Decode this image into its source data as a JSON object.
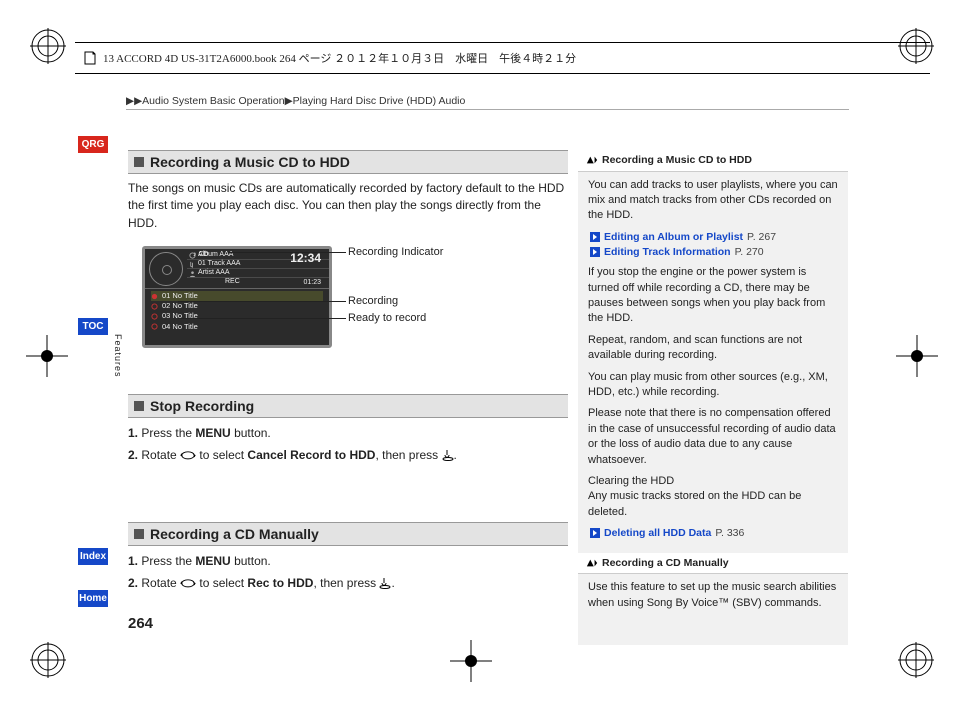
{
  "header_text": "13 ACCORD 4D US-31T2A6000.book  264 ページ  ２０１２年１０月３日　水曜日　午後４時２１分",
  "breadcrumb_prefix": "▶▶",
  "breadcrumb_a": "Audio System Basic Operation",
  "breadcrumb_sep": "▶",
  "breadcrumb_b": "Playing Hard Disc Drive (HDD) Audio",
  "tabs": {
    "qrg": "QRG",
    "toc": "TOC",
    "index": "Index",
    "home": "Home",
    "features": "Features"
  },
  "page_number": "264",
  "section1": {
    "title": "Recording a Music CD to HDD",
    "body": "The songs on music CDs are automatically recorded by factory default to the HDD the first time you play each disc. You can then play the songs directly from the HDD.",
    "callouts": {
      "indicator": "Recording Indicator",
      "recording": "Recording",
      "ready": "Ready to record"
    },
    "screen": {
      "cd": "CD",
      "time": "12:34",
      "elapsed": "01:23",
      "album": "Album AAA",
      "track": "01 Track AAA",
      "artist": "Artist AAA",
      "rec_btn": "REC",
      "tracks": [
        "01 No Title",
        "02 No Title",
        "03 No Title",
        "04 No Title"
      ]
    }
  },
  "section2": {
    "title": "Stop Recording",
    "step1_a": "1.",
    "step1_b": "Press the ",
    "step1_menu": "MENU",
    "step1_c": " button.",
    "step2_a": "2.",
    "step2_b": "Rotate ",
    "step2_c": " to select ",
    "step2_bold": "Cancel Record to HDD",
    "step2_d": ", then press "
  },
  "section3": {
    "title": "Recording a CD Manually",
    "step1_a": "1.",
    "step1_b": "Press the ",
    "step1_menu": "MENU",
    "step1_c": " button.",
    "step2_a": "2.",
    "step2_b": "Rotate ",
    "step2_c": " to select ",
    "step2_bold": "Rec to HDD",
    "step2_d": ", then press "
  },
  "sidebar": {
    "heading1": "Recording a Music CD to HDD",
    "p1": "You can add tracks to user playlists, where you can mix and match tracks from other CDs recorded on the HDD.",
    "xref1": "Editing an Album or Playlist",
    "xref1_pg": "P. 267",
    "xref2": "Editing Track Information",
    "xref2_pg": "P. 270",
    "p2": "If you stop the engine or the power system is turned off while recording a CD, there may be pauses between songs when you play back from the HDD.",
    "p3": "Repeat, random, and scan functions are not available during recording.",
    "p4": "You can play music from other sources (e.g., XM, HDD, etc.) while recording.",
    "p5": "Please note that there is no compensation offered in the case of unsuccessful recording of audio data or the loss of audio data due to any cause whatsoever.",
    "p6a": "Clearing the HDD",
    "p6b": "Any music tracks stored on the HDD can be deleted.",
    "xref3": "Deleting all HDD Data",
    "xref3_pg": "P. 336",
    "heading2": "Recording a CD Manually",
    "p7": "Use this feature to set up the music search abilities when using Song By Voice™ (SBV) commands."
  }
}
